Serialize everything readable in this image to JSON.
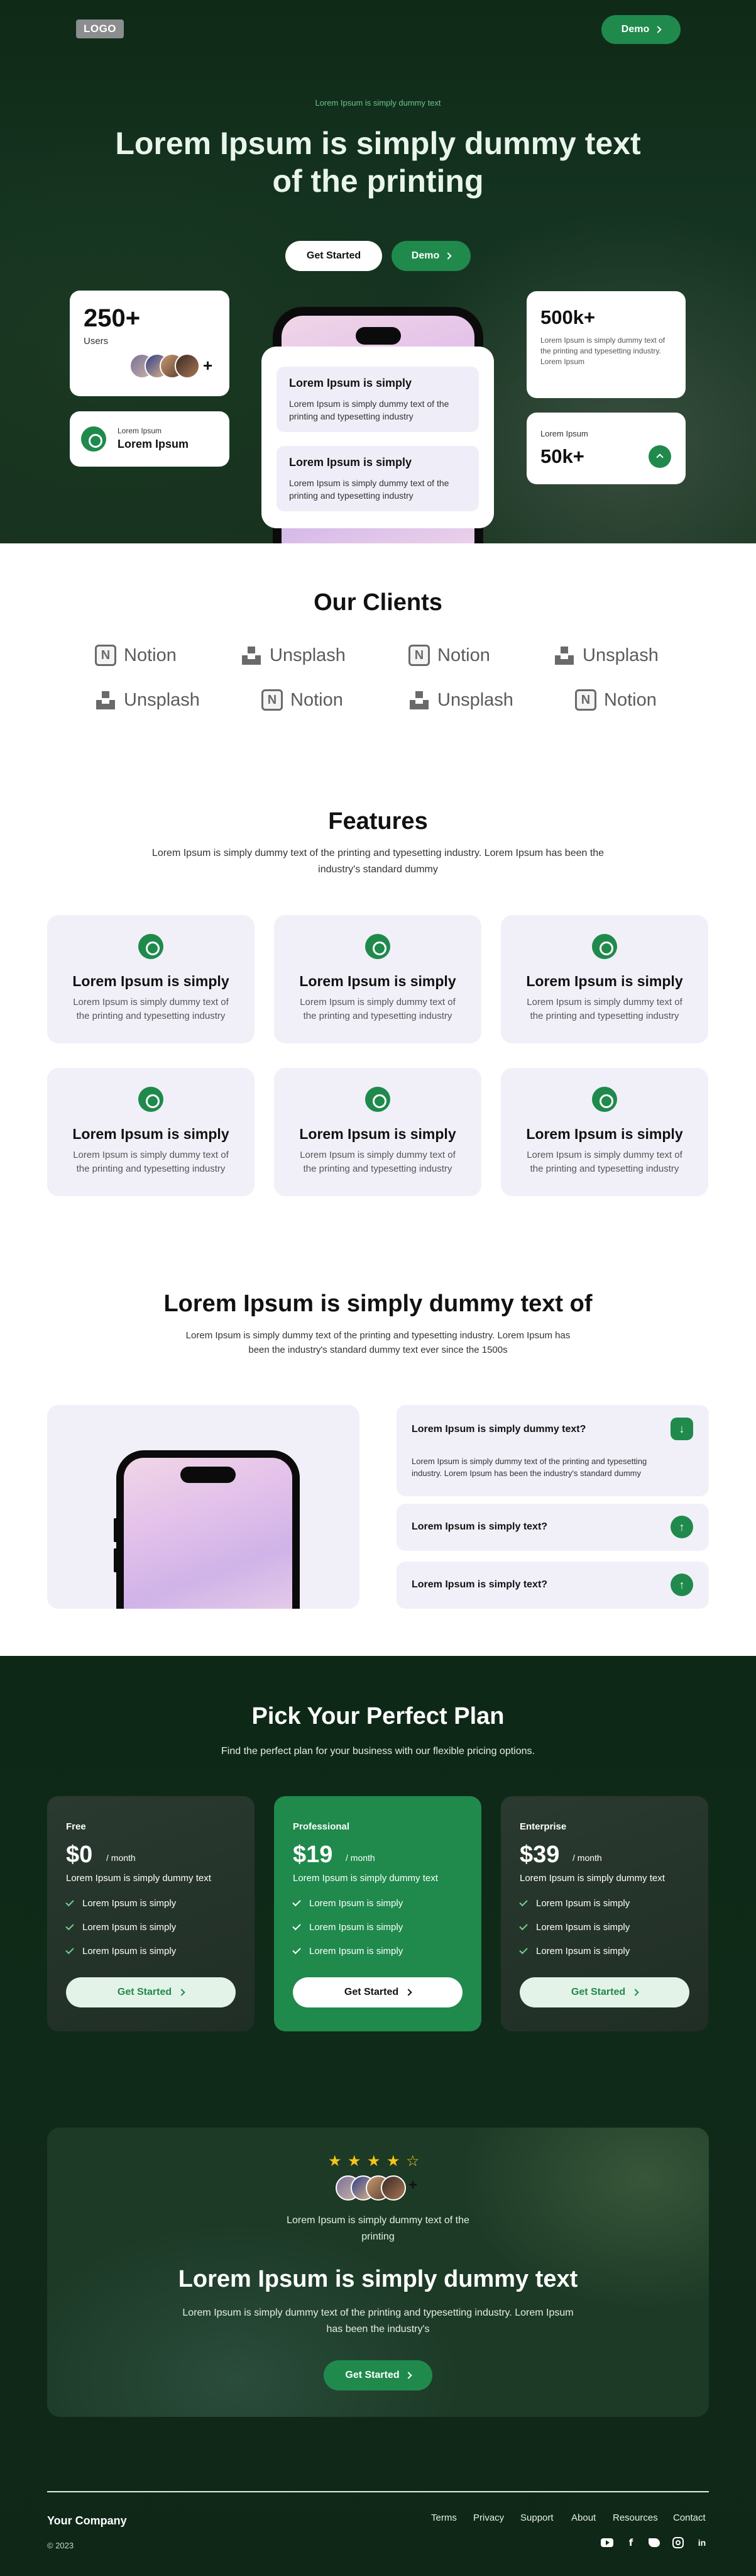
{
  "header": {
    "logo": "LOGO",
    "demo_label": "Demo"
  },
  "hero": {
    "eyebrow": "Lorem Ipsum is simply dummy text",
    "title": "Lorem Ipsum is simply dummy text of the printing",
    "get_started": "Get Started",
    "demo": "Demo",
    "users_count": "250+",
    "users_label": "Users",
    "avatars_more": "+",
    "small_card_label": "Lorem Ipsum",
    "small_card_title": "Lorem Ipsum",
    "phone_card1_title": "Lorem Ipsum is simply",
    "phone_card1_text": "Lorem Ipsum is simply dummy text of the printing and typesetting industry",
    "phone_card2_title": "Lorem Ipsum is simply",
    "phone_card2_text": "Lorem Ipsum is simply dummy text of the printing and typesetting industry",
    "stat_count": "500k+",
    "stat_text": "Lorem Ipsum is simply dummy text of the printing and typesetting industry. Lorem Ipsum",
    "growth_label": "Lorem Ipsum",
    "growth_value": "50k+"
  },
  "clients": {
    "title": "Our Clients",
    "row1": [
      "Notion",
      "Unsplash",
      "Notion",
      "Unsplash"
    ],
    "row2": [
      "Unsplash",
      "Notion",
      "Unsplash",
      "Notion"
    ]
  },
  "features": {
    "title": "Features",
    "subtitle": "Lorem Ipsum is simply dummy text of the printing and typesetting industry. Lorem Ipsum has been the industry's standard dummy",
    "items": [
      {
        "title": "Lorem Ipsum is simply",
        "text": "Lorem Ipsum is simply dummy text of the printing and typesetting industry"
      },
      {
        "title": "Lorem Ipsum is simply",
        "text": "Lorem Ipsum is simply dummy text of the printing and typesetting industry"
      },
      {
        "title": "Lorem Ipsum is simply",
        "text": "Lorem Ipsum is simply dummy text of the printing and typesetting industry"
      },
      {
        "title": "Lorem Ipsum is simply",
        "text": "Lorem Ipsum is simply dummy text of the printing and typesetting industry"
      },
      {
        "title": "Lorem Ipsum is simply",
        "text": "Lorem Ipsum is simply dummy text of the printing and typesetting industry"
      },
      {
        "title": "Lorem Ipsum is simply",
        "text": "Lorem Ipsum is simply dummy text of the printing and typesetting industry"
      }
    ]
  },
  "faq_section": {
    "title": "Lorem Ipsum is simply dummy text of",
    "subtitle": "Lorem Ipsum is simply dummy text of the printing and typesetting industry. Lorem Ipsum has been the industry's standard dummy text ever since the 1500s",
    "items": [
      {
        "question": "Lorem Ipsum is simply dummy text?",
        "answer": "Lorem Ipsum is simply dummy text of the printing and typesetting industry. Lorem Ipsum has been the industry's standard dummy"
      },
      {
        "question": "Lorem Ipsum is simply text?"
      },
      {
        "question": "Lorem Ipsum is simply text?"
      }
    ]
  },
  "pricing": {
    "title": "Pick Your Perfect Plan",
    "subtitle": "Find the perfect plan for your business with our flexible pricing options.",
    "plans": [
      {
        "name": "Free",
        "price": "$0",
        "period": "/ month",
        "desc": "Lorem Ipsum is simply dummy text",
        "features": [
          "Lorem Ipsum is simply",
          "Lorem Ipsum is simply",
          "Lorem Ipsum is simply"
        ],
        "cta": "Get Started"
      },
      {
        "name": "Professional",
        "price": "$19",
        "period": "/ month",
        "desc": "Lorem Ipsum is simply dummy text",
        "features": [
          "Lorem Ipsum is simply",
          "Lorem Ipsum is simply",
          "Lorem Ipsum is simply"
        ],
        "cta": "Get Started"
      },
      {
        "name": "Enterprise",
        "price": "$39",
        "period": "/ month",
        "desc": "Lorem Ipsum is simply dummy text",
        "features": [
          "Lorem Ipsum is simply",
          "Lorem Ipsum is simply",
          "Lorem Ipsum is simply"
        ],
        "cta": "Get Started"
      }
    ]
  },
  "cta": {
    "rating_stars": 4.5,
    "avatars_more": "+",
    "caption": "Lorem Ipsum is simply dummy text of the printing",
    "title": "Lorem Ipsum is simply dummy text",
    "text": "Lorem Ipsum is simply dummy text of the printing and typesetting industry. Lorem Ipsum has been the industry's",
    "button": "Get Started"
  },
  "footer": {
    "company": "Your Company",
    "copyright": "© 2023",
    "links": [
      "Terms",
      "Privacy",
      "Support",
      "About",
      "Resources",
      "Contact"
    ],
    "socials": [
      "youtube-icon",
      "facebook-icon",
      "twitter-icon",
      "instagram-icon",
      "linkedin-icon"
    ]
  },
  "colors": {
    "brand_green": "#1f8a4c",
    "hero_bg": "#143320",
    "card_lavender": "#f1f0f9",
    "star": "#f5c518"
  }
}
